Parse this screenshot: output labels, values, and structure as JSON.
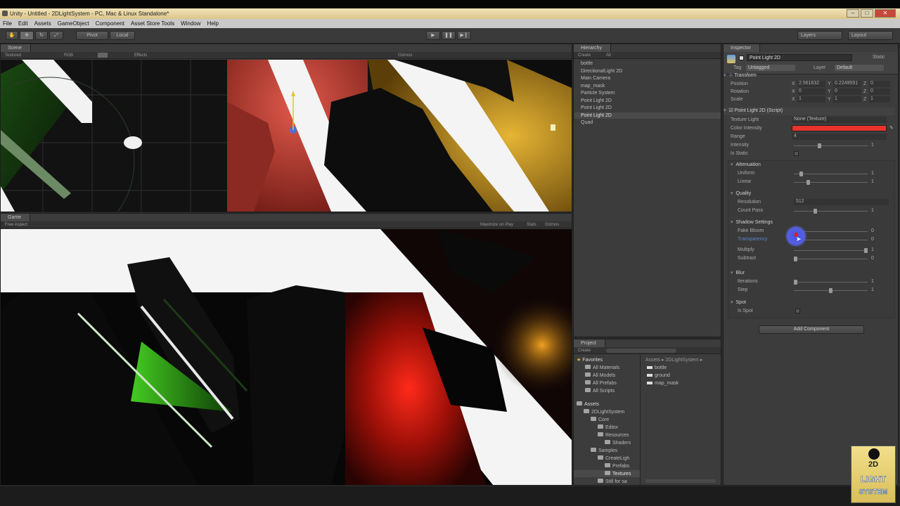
{
  "window": {
    "title": "Unity - Untitled - 2DLightSystem - PC, Mac & Linux Standalone*"
  },
  "menu": [
    "File",
    "Edit",
    "Assets",
    "GameObject",
    "Component",
    "Asset Store Tools",
    "Window",
    "Help"
  ],
  "toolbar": {
    "pivot_label": "Pivot",
    "local_label": "Local",
    "layers_label": "Layers",
    "layout_label": "Layout"
  },
  "scene": {
    "tab": "Scene",
    "shading": "Textured",
    "mode": "RGB",
    "effects": "Effects",
    "gizmos": "Gizmos"
  },
  "game": {
    "tab": "Game",
    "aspect": "Free Aspect",
    "maximize": "Maximize on Play",
    "stats": "Stats",
    "gizmos": "Gizmos"
  },
  "hierarchy": {
    "tab": "Hierarchy",
    "create": "Create",
    "search": "All",
    "items": [
      "bottle",
      "DirectionalLight 2D",
      "Main Camera",
      "map_mask",
      "Particle System",
      "Point Light 2D",
      "Point Light 2D",
      "Point Light 2D",
      "Quad"
    ],
    "selected_index": 7
  },
  "project": {
    "tab": "Project",
    "create": "Create",
    "breadcrumb": "Assets ▸ 2DLightSystem ▸",
    "favorites_label": "Favorites",
    "favorites": [
      "All Materials",
      "All Models",
      "All Prefabs",
      "All Scripts"
    ],
    "assets_label": "Assets",
    "tree": [
      "2DLightSystem",
      "Core",
      "Editor",
      "Resources",
      "Shaders",
      "Samples",
      "CreateLigh",
      "Prefabs",
      "Textures",
      "Still for sa"
    ],
    "files": [
      "bottle",
      "ground",
      "map_mask"
    ]
  },
  "inspector": {
    "tab": "Inspector",
    "object_name": "Point Light 2D",
    "static": "Static",
    "tag_label": "Tag",
    "tag": "Untagged",
    "layer_label": "Layer",
    "layer": "Default",
    "transform": {
      "title": "Transform",
      "position_label": "Position",
      "rotation_label": "Rotation",
      "scale_label": "Scale",
      "position": [
        "2.561632",
        "0.2249591",
        "0"
      ],
      "rotation": [
        "0",
        "0",
        "0"
      ],
      "scale": [
        "1",
        "1",
        "1"
      ]
    },
    "component": {
      "title": "Point Light 2D (Script)",
      "texture_light_label": "Texture Light",
      "texture_light": "None (Texture)",
      "color_label": "Color Intensity",
      "color": "#e8342c",
      "range_label": "Range",
      "range": "4",
      "intensity_label": "Intensity",
      "intensity": "1",
      "is_static_label": "Is Static",
      "attenuation": "Attenuation",
      "uniform_label": "Uniform",
      "uniform": "1",
      "linear_label": "Linear",
      "linear": "1",
      "quality": "Quality",
      "resolution_label": "Resolution",
      "resolution": "512",
      "count_pass_label": "Count Pass",
      "count_pass": "1",
      "shadow_settings": "Shadow Settings",
      "fake_bloom_label": "Fake Bloom",
      "fake_bloom": "0",
      "transparency_label": "Transparency",
      "transparency": "0",
      "multiply_label": "Multiply",
      "multiply": "1",
      "subtract_label": "Subtract",
      "subtract": "0",
      "blur": "Blur",
      "iterations_label": "Iterations",
      "iterations": "1",
      "step_label": "Step",
      "step": "1",
      "spot": "Spot",
      "is_spot_label": "Is Spot"
    },
    "add_component": "Add Component"
  },
  "logo": {
    "line1": "2D",
    "line2": "LIGHT",
    "line3": "SYSTEM"
  }
}
